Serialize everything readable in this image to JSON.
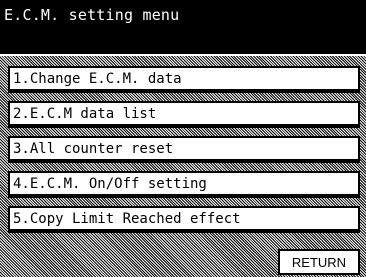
{
  "header": {
    "title": "E.C.M. setting menu"
  },
  "menu": {
    "items": [
      {
        "label": "1.Change E.C.M. data"
      },
      {
        "label": "2.E.C.M data list"
      },
      {
        "label": "3.All counter reset"
      },
      {
        "label": "4.E.C.M. On/Off setting"
      },
      {
        "label": "5.Copy Limit Reached effect"
      }
    ]
  },
  "footer": {
    "return_label": "RETURN"
  },
  "colors": {
    "title_background": "#000000",
    "title_text": "#ffffff",
    "button_background": "#ffffff",
    "button_border": "#000000"
  }
}
